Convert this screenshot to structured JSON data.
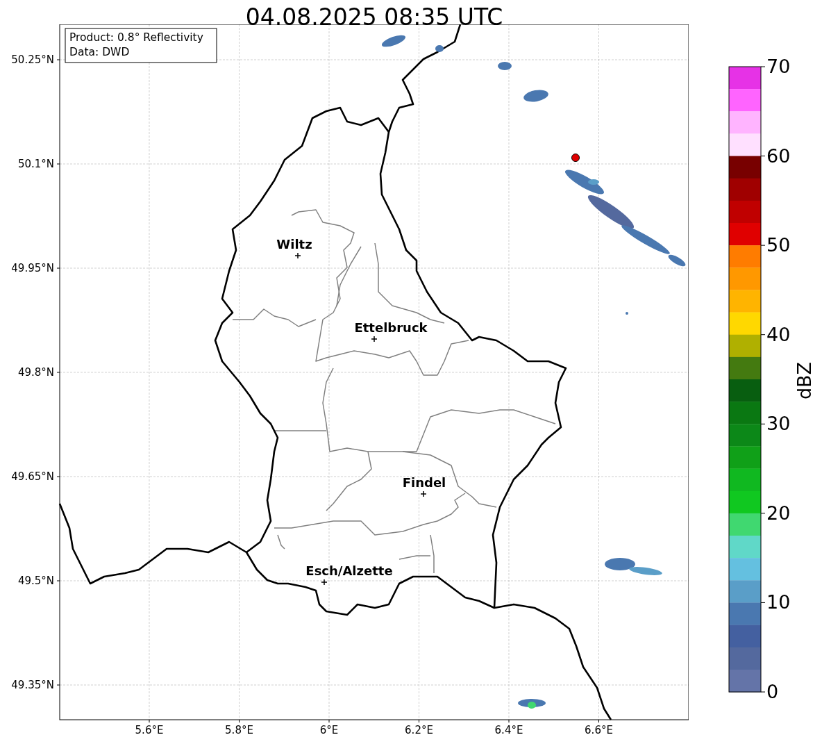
{
  "title": "04.08.2025 08:35 UTC",
  "info_box": [
    "Product: 0.8° Reflectivity",
    "Data: DWD"
  ],
  "x_ticks": [
    "5.6°E",
    "5.8°E",
    "6°E",
    "6.2°E",
    "6.4°E",
    "6.6°E"
  ],
  "y_ticks": [
    "50.25°N",
    "50.1°N",
    "49.95°N",
    "49.8°N",
    "49.65°N",
    "49.5°N",
    "49.35°N"
  ],
  "cities": [
    "Wiltz",
    "Ettelbruck",
    "Findel",
    "Esch/Alzette"
  ],
  "colorbar": {
    "label": "dBZ",
    "ticks": [
      "70",
      "60",
      "50",
      "40",
      "30",
      "20",
      "10",
      "0"
    ],
    "bins": [
      {
        "color": "#e632e6"
      },
      {
        "color": "#ff64ff"
      },
      {
        "color": "#ffb4ff"
      },
      {
        "color": "#ffe0ff"
      },
      {
        "color": "#780000"
      },
      {
        "color": "#a00000"
      },
      {
        "color": "#c00000"
      },
      {
        "color": "#e00000"
      },
      {
        "color": "#ff7c00"
      },
      {
        "color": "#ff9800"
      },
      {
        "color": "#ffb400"
      },
      {
        "color": "#ffd800"
      },
      {
        "color": "#b0b000"
      },
      {
        "color": "#447a10"
      },
      {
        "color": "#085e10"
      },
      {
        "color": "#0a7812"
      },
      {
        "color": "#0c8818"
      },
      {
        "color": "#10a018"
      },
      {
        "color": "#10b820"
      },
      {
        "color": "#10c820"
      },
      {
        "color": "#40d870"
      },
      {
        "color": "#60d8c8"
      },
      {
        "color": "#64c0e0"
      },
      {
        "color": "#5a9ec8"
      },
      {
        "color": "#4a78b0"
      },
      {
        "color": "#4460a0"
      },
      {
        "color": "#54699e"
      },
      {
        "color": "#6474a8"
      }
    ]
  }
}
